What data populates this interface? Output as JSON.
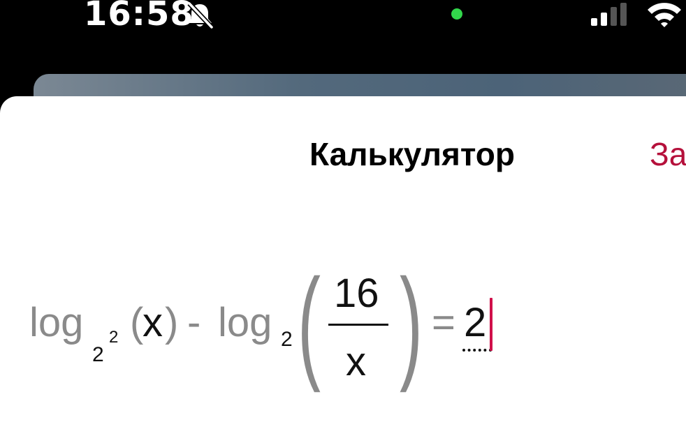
{
  "status_bar": {
    "time": "16:58",
    "icons": [
      "bell-slash-icon",
      "green-dot-indicator",
      "cellular-signal-icon",
      "wifi-icon"
    ],
    "dot_color": "#32d74b"
  },
  "sheet": {
    "title": "Калькулятор",
    "close_label": "За",
    "accent_color": "#b5103b"
  },
  "formula": {
    "log1": "log",
    "log1_base": "2",
    "log1_base_power": "2",
    "paren_open_1": "(",
    "arg1": "x",
    "paren_close_1": ")",
    "minus": "-",
    "log2": "log",
    "log2_base": "2",
    "paren_open_2": "(",
    "numerator": "16",
    "denominator": "x",
    "paren_close_2": ")",
    "equals": "=",
    "rhs": "2"
  }
}
